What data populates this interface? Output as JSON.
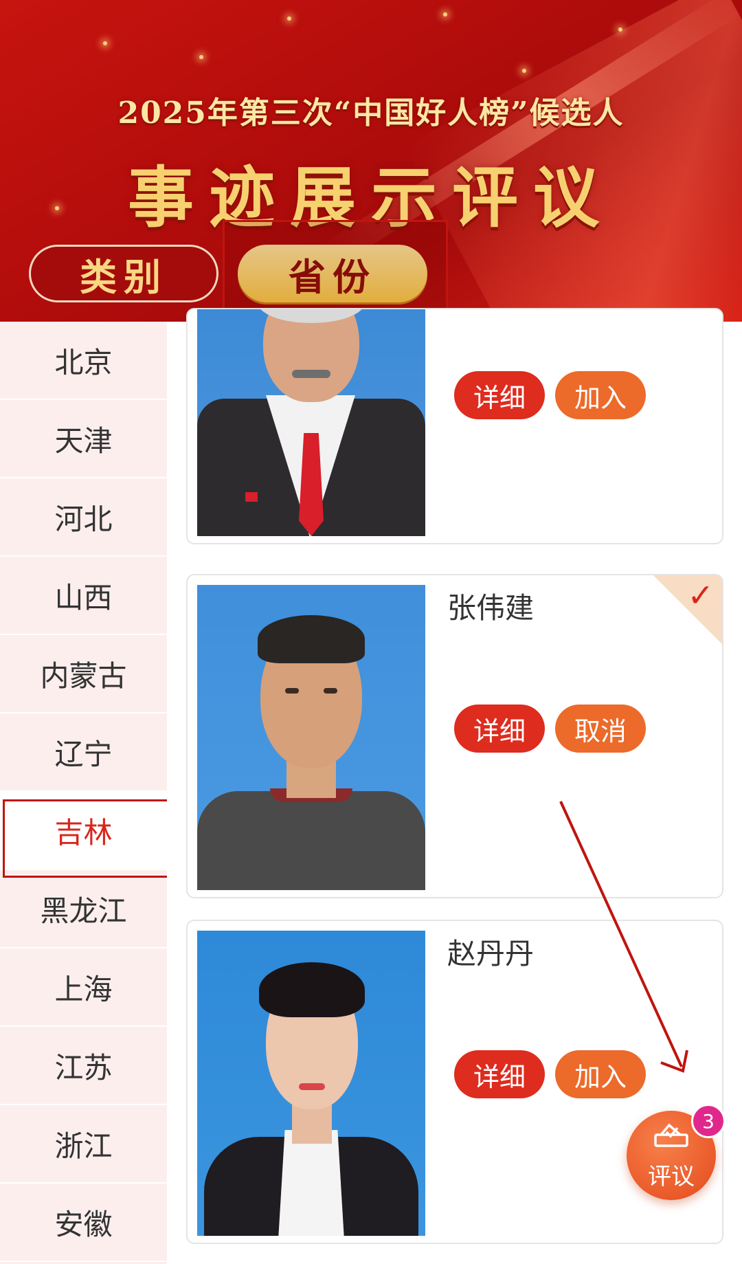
{
  "banner": {
    "subtitle": "2025年第三次“中国好人榜”候选人",
    "title": "事迹展示评议",
    "tabs": [
      {
        "label": "类别",
        "selected": false
      },
      {
        "label": "省份",
        "selected": true
      }
    ]
  },
  "sidebar": {
    "provinces": [
      "北京",
      "天津",
      "河北",
      "山西",
      "内蒙古",
      "辽宁",
      "吉林",
      "黑龙江",
      "上海",
      "江苏",
      "浙江",
      "安徽"
    ],
    "selected": "吉林"
  },
  "candidates": [
    {
      "name": "",
      "detail_label": "详细",
      "action_label": "加入",
      "joined": false
    },
    {
      "name": "张伟建",
      "detail_label": "详细",
      "action_label": "取消",
      "joined": true
    },
    {
      "name": "赵丹丹",
      "detail_label": "详细",
      "action_label": "加入",
      "joined": false
    }
  ],
  "fab": {
    "label": "评议",
    "badge": "3",
    "icon": "ballot-box-icon"
  },
  "colors": {
    "banner_red": "#b30d0c",
    "gold_text": "#f7d170",
    "detail_button": "#de2c1f",
    "action_button": "#ec6a2a",
    "active_province": "#d8261c",
    "badge": "#e0288c"
  }
}
